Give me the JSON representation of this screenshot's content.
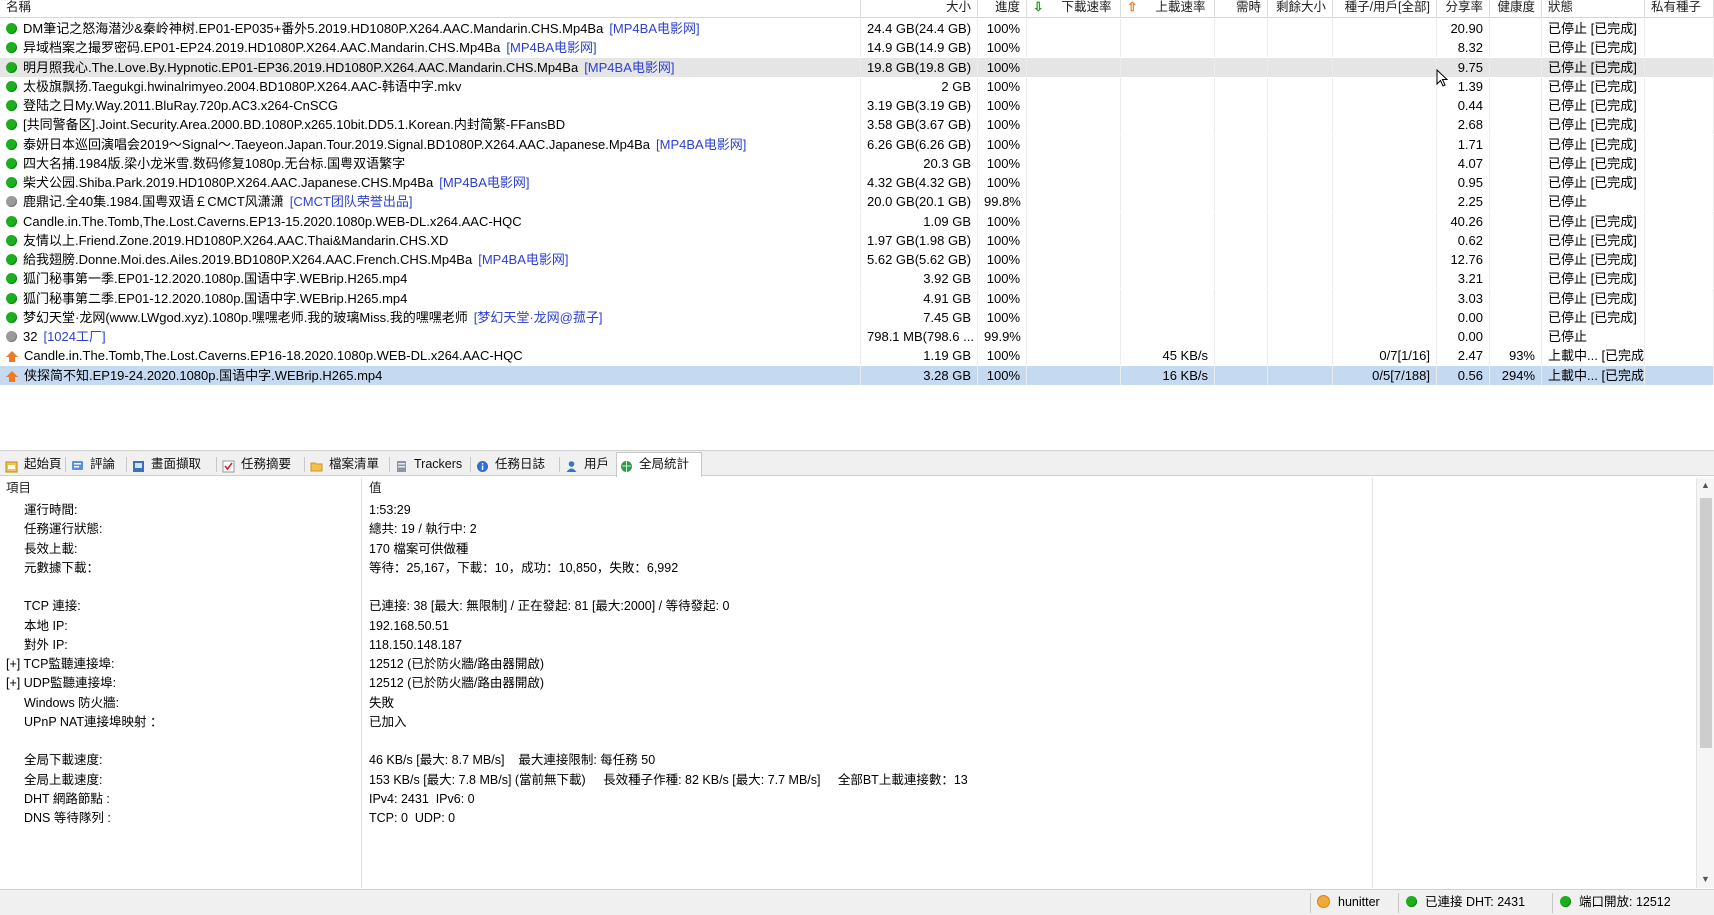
{
  "columns": {
    "name": "名稱",
    "size": "大小",
    "progress": "進度",
    "dl_speed": "下載速率",
    "ul_speed": "上載速率",
    "eta": "需時",
    "remaining": "剩餘大小",
    "peers": "種子/用戶[全部]",
    "ratio": "分享率",
    "health": "健康度",
    "status": "狀態",
    "private": "私有種子"
  },
  "torrents": [
    {
      "icon": "green",
      "name": "DM筆记之怒海潜沙&秦岭神树.EP01-EP035+番外5.2019.HD1080P.X264.AAC.Mandarin.CHS.Mp4Ba",
      "tag": "[MP4BA电影网]",
      "size": "24.4 GB(24.4 GB)",
      "progress": "100%",
      "dl": "",
      "ul": "",
      "eta": "",
      "remaining": "",
      "peers": "",
      "ratio": "20.90",
      "health": "",
      "status": "已停止 [已完成]"
    },
    {
      "icon": "green",
      "name": "异域档案之撮罗密码.EP01-EP24.2019.HD1080P.X264.AAC.Mandarin.CHS.Mp4Ba",
      "tag": "[MP4BA电影网]",
      "size": "14.9 GB(14.9 GB)",
      "progress": "100%",
      "dl": "",
      "ul": "",
      "eta": "",
      "remaining": "",
      "peers": "",
      "ratio": "8.32",
      "health": "",
      "status": "已停止 [已完成]"
    },
    {
      "icon": "green",
      "name": "明月照我心.The.Love.By.Hypnotic.EP01-EP36.2019.HD1080P.X264.AAC.Mandarin.CHS.Mp4Ba",
      "tag": "[MP4BA电影网]",
      "size": "19.8 GB(19.8 GB)",
      "progress": "100%",
      "dl": "",
      "ul": "",
      "eta": "",
      "remaining": "",
      "peers": "",
      "ratio": "9.75",
      "health": "",
      "status": "已停止 [已完成]"
    },
    {
      "icon": "green",
      "name": "太极旗飘扬.Taegukgi.hwinalrimyeo.2004.BD1080P.X264.AAC-韩语中字.mkv",
      "tag": "",
      "size": "2 GB",
      "progress": "100%",
      "dl": "",
      "ul": "",
      "eta": "",
      "remaining": "",
      "peers": "",
      "ratio": "1.39",
      "health": "",
      "status": "已停止 [已完成]"
    },
    {
      "icon": "green",
      "name": "登陆之日My.Way.2011.BluRay.720p.AC3.x264-CnSCG",
      "tag": "",
      "size": "3.19 GB(3.19 GB)",
      "progress": "100%",
      "dl": "",
      "ul": "",
      "eta": "",
      "remaining": "",
      "peers": "",
      "ratio": "0.44",
      "health": "",
      "status": "已停止 [已完成]"
    },
    {
      "icon": "green",
      "name": "[共同警备区].Joint.Security.Area.2000.BD.1080P.x265.10bit.DD5.1.Korean.内封简繁-FFansBD",
      "tag": "",
      "size": "3.58 GB(3.67 GB)",
      "progress": "100%",
      "dl": "",
      "ul": "",
      "eta": "",
      "remaining": "",
      "peers": "",
      "ratio": "2.68",
      "health": "",
      "status": "已停止 [已完成]"
    },
    {
      "icon": "green",
      "name": "泰妍日本巡回演唱会2019～Signal～.Taeyeon.Japan.Tour.2019.Signal.BD1080P.X264.AAC.Japanese.Mp4Ba",
      "tag": "[MP4BA电影网]",
      "size": "6.26 GB(6.26 GB)",
      "progress": "100%",
      "dl": "",
      "ul": "",
      "eta": "",
      "remaining": "",
      "peers": "",
      "ratio": "1.71",
      "health": "",
      "status": "已停止 [已完成]"
    },
    {
      "icon": "green",
      "name": "四大名捕.1984版.梁小龙米雪.数码修复1080p.无台标.国粤双语繁字",
      "tag": "",
      "size": "20.3 GB",
      "progress": "100%",
      "dl": "",
      "ul": "",
      "eta": "",
      "remaining": "",
      "peers": "",
      "ratio": "4.07",
      "health": "",
      "status": "已停止 [已完成]"
    },
    {
      "icon": "green",
      "name": "柴犬公园.Shiba.Park.2019.HD1080P.X264.AAC.Japanese.CHS.Mp4Ba",
      "tag": "[MP4BA电影网]",
      "size": "4.32 GB(4.32 GB)",
      "progress": "100%",
      "dl": "",
      "ul": "",
      "eta": "",
      "remaining": "",
      "peers": "",
      "ratio": "0.95",
      "health": "",
      "status": "已停止 [已完成]"
    },
    {
      "icon": "gray",
      "name": "鹿鼎记.全40集.1984.国粤双语￡CMCT风潇潇",
      "tag": "[CMCT团队荣誉出品]",
      "size": "20.0 GB(20.1 GB)",
      "progress": "99.8%",
      "dl": "",
      "ul": "",
      "eta": "",
      "remaining": "",
      "peers": "",
      "ratio": "2.25",
      "health": "",
      "status": "已停止"
    },
    {
      "icon": "green",
      "name": "Candle.in.The.Tomb,The.Lost.Caverns.EP13-15.2020.1080p.WEB-DL.x264.AAC-HQC",
      "tag": "",
      "size": "1.09 GB",
      "progress": "100%",
      "dl": "",
      "ul": "",
      "eta": "",
      "remaining": "",
      "peers": "",
      "ratio": "40.26",
      "health": "",
      "status": "已停止 [已完成]"
    },
    {
      "icon": "green",
      "name": "友情以上.Friend.Zone.2019.HD1080P.X264.AAC.Thai&Mandarin.CHS.XD",
      "tag": "",
      "size": "1.97 GB(1.98 GB)",
      "progress": "100%",
      "dl": "",
      "ul": "",
      "eta": "",
      "remaining": "",
      "peers": "",
      "ratio": "0.62",
      "health": "",
      "status": "已停止 [已完成]"
    },
    {
      "icon": "green",
      "name": "給我翅膀.Donne.Moi.des.Ailes.2019.BD1080P.X264.AAC.French.CHS.Mp4Ba",
      "tag": "[MP4BA电影网]",
      "size": "5.62 GB(5.62 GB)",
      "progress": "100%",
      "dl": "",
      "ul": "",
      "eta": "",
      "remaining": "",
      "peers": "",
      "ratio": "12.76",
      "health": "",
      "status": "已停止 [已完成]"
    },
    {
      "icon": "green",
      "name": "狐门秘事第一季.EP01-12.2020.1080p.国语中字.WEBrip.H265.mp4",
      "tag": "",
      "size": "3.92 GB",
      "progress": "100%",
      "dl": "",
      "ul": "",
      "eta": "",
      "remaining": "",
      "peers": "",
      "ratio": "3.21",
      "health": "",
      "status": "已停止 [已完成]"
    },
    {
      "icon": "green",
      "name": "狐门秘事第二季.EP01-12.2020.1080p.国语中字.WEBrip.H265.mp4",
      "tag": "",
      "size": "4.91 GB",
      "progress": "100%",
      "dl": "",
      "ul": "",
      "eta": "",
      "remaining": "",
      "peers": "",
      "ratio": "3.03",
      "health": "",
      "status": "已停止 [已完成]"
    },
    {
      "icon": "green",
      "name": "梦幻天堂·龙网(www.LWgod.xyz).1080p.嘿嘿老师.我的玻璃Miss.我的嘿嘿老师",
      "tag": "[梦幻天堂·龙网@菰子]",
      "size": "7.45 GB",
      "progress": "100%",
      "dl": "",
      "ul": "",
      "eta": "",
      "remaining": "",
      "peers": "",
      "ratio": "0.00",
      "health": "",
      "status": "已停止 [已完成]"
    },
    {
      "icon": "gray",
      "name": "32",
      "tag": "[1024工厂]",
      "size": "798.1 MB(798.6 ...",
      "progress": "99.9%",
      "dl": "",
      "ul": "",
      "eta": "",
      "remaining": "",
      "peers": "",
      "ratio": "0.00",
      "health": "",
      "status": "已停止"
    },
    {
      "icon": "upload",
      "name": "Candle.in.The.Tomb,The.Lost.Caverns.EP16-18.2020.1080p.WEB-DL.x264.AAC-HQC",
      "tag": "",
      "size": "1.19 GB",
      "progress": "100%",
      "dl": "",
      "ul": "45 KB/s",
      "eta": "",
      "remaining": "",
      "peers": "0/7[1/16]",
      "ratio": "2.47",
      "health": "93%",
      "status": "上載中... [已完成]"
    },
    {
      "icon": "upload",
      "name": "侠探简不知.EP19-24.2020.1080p.国语中字.WEBrip.H265.mp4",
      "tag": "",
      "size": "3.28 GB",
      "progress": "100%",
      "dl": "",
      "ul": "16 KB/s",
      "eta": "",
      "remaining": "",
      "peers": "0/5[7/188]",
      "ratio": "0.56",
      "health": "294%",
      "status": "上載中... [已完成]"
    }
  ],
  "tabs": [
    "起始頁",
    "評論",
    "畫面擷取",
    "任務摘要",
    "檔案清單",
    "Trackers",
    "任務日誌",
    "用戶",
    "全局統計"
  ],
  "stats_header": {
    "item": "項目",
    "value": "值"
  },
  "stats": [
    {
      "label": "運行時間:",
      "value": "1:53:29",
      "plus": false
    },
    {
      "label": "任務運行狀態:",
      "value": "總共: 19 / 執行中: 2",
      "plus": false
    },
    {
      "label": "長效上載:",
      "value": "170 檔案可供做種",
      "plus": false
    },
    {
      "label": "元數據下載：",
      "value": "等待：25,167，下載：10，成功：10,850，失敗：6,992",
      "plus": false
    },
    {
      "label": "",
      "value": "",
      "plus": false
    },
    {
      "label": "TCP 連接:",
      "value": "已連接: 38 [最大: 無限制] / 正在發起: 81 [最大:2000] / 等待發起: 0",
      "plus": false
    },
    {
      "label": "本地 IP:",
      "value": "192.168.50.51",
      "plus": false
    },
    {
      "label": "對外 IP:",
      "value": "118.150.148.187",
      "plus": false
    },
    {
      "label": "[+] TCP監聽連接埠:",
      "value": "12512 (已於防火牆/路由器開啟)",
      "plus": true
    },
    {
      "label": "[+] UDP監聽連接埠:",
      "value": "12512 (已於防火牆/路由器開啟)",
      "plus": true
    },
    {
      "label": "Windows 防火牆:",
      "value": "失敗",
      "plus": false
    },
    {
      "label": "UPnP NAT連接埠映射 ：",
      "value": "已加入",
      "plus": false
    },
    {
      "label": "",
      "value": "",
      "plus": false
    },
    {
      "label": "全局下載速度:",
      "value": "46 KB/s [最大: 8.7 MB/s]    最大連接限制: 每任務 50",
      "plus": false
    },
    {
      "label": "全局上載速度:",
      "value": "153 KB/s [最大: 7.8 MB/s] (當前無下載)     長效種子作種: 82 KB/s [最大: 7.7 MB/s]     全部BT上載連接數：13",
      "plus": false
    },
    {
      "label": "DHT 網路節點 :",
      "value": "IPv4: 2431  IPv6: 0",
      "plus": false
    },
    {
      "label": "DNS 等待隊列 :",
      "value": "TCP: 0  UDP: 0",
      "plus": false
    }
  ],
  "statusbar": {
    "user": "hunitter",
    "dht": "已連接 DHT: 2431",
    "port": "端口開放: 12512"
  }
}
